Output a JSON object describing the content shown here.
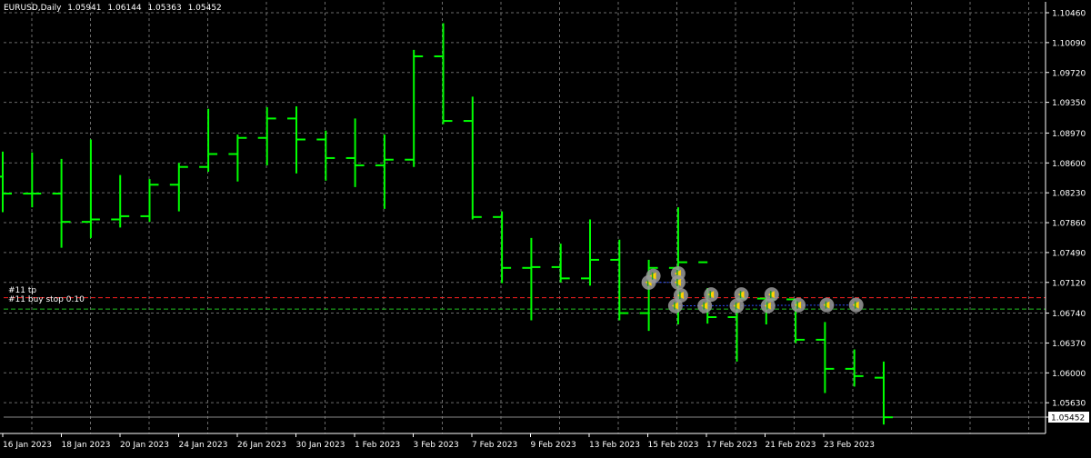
{
  "header": {
    "symbol": "EURUSD,Daily",
    "open": "1.05941",
    "high": "1.06144",
    "low": "1.05363",
    "close": "1.05452"
  },
  "pending": {
    "tp_label": "#11 tp",
    "order_label": "#11 buy stop 0.10",
    "tp_price": 1.0693,
    "order_price": 1.0679,
    "tp_color": "#ff2020",
    "order_color": "#20c020"
  },
  "current_price_label": "1.05452",
  "colors": {
    "background": "#000000",
    "bar": "#00ff00",
    "grid": "#6b6b6b",
    "axis": "#ffffff"
  },
  "chart_data": {
    "type": "ohlc",
    "ylim": [
      1.051,
      1.1052
    ],
    "y_ticks": [
      1.1046,
      1.1009,
      1.0972,
      1.0935,
      1.0897,
      1.086,
      1.0823,
      1.0786,
      1.0749,
      1.0712,
      1.0674,
      1.0637,
      1.06,
      1.0563,
      1.05452
    ],
    "y_tick_labels": [
      "1.10460",
      "1.10090",
      "1.09720",
      "1.09350",
      "1.08970",
      "1.08600",
      "1.08230",
      "1.07860",
      "1.07490",
      "1.07120",
      "1.06740",
      "1.06370",
      "1.06000",
      "1.05630",
      "1.05452"
    ],
    "x_tick_labels": [
      "16 Jan 2023",
      "18 Jan 2023",
      "20 Jan 2023",
      "24 Jan 2023",
      "26 Jan 2023",
      "30 Jan 2023",
      "1 Feb 2023",
      "3 Feb 2023",
      "7 Feb 2023",
      "9 Feb 2023",
      "13 Feb 2023",
      "15 Feb 2023",
      "17 Feb 2023",
      "21 Feb 2023",
      "23 Feb 2023"
    ],
    "bars": [
      {
        "date": "13 Jan 2023",
        "o": 1.0843,
        "h": 1.0874,
        "l": 1.0799,
        "c": 1.0822
      },
      {
        "date": "16 Jan 2023",
        "o": 1.0822,
        "h": 1.0873,
        "l": 1.0805,
        "c": 1.0822
      },
      {
        "date": "17 Jan 2023",
        "o": 1.0822,
        "h": 1.0865,
        "l": 1.0755,
        "c": 1.0787
      },
      {
        "date": "18 Jan 2023",
        "o": 1.0787,
        "h": 1.0889,
        "l": 1.0767,
        "c": 1.079
      },
      {
        "date": "19 Jan 2023",
        "o": 1.079,
        "h": 1.0845,
        "l": 1.078,
        "c": 1.0794
      },
      {
        "date": "20 Jan 2023",
        "o": 1.0794,
        "h": 1.084,
        "l": 1.0787,
        "c": 1.0833
      },
      {
        "date": "23 Jan 2023",
        "o": 1.0833,
        "h": 1.086,
        "l": 1.08,
        "c": 1.0855
      },
      {
        "date": "24 Jan 2023",
        "o": 1.0855,
        "h": 1.0927,
        "l": 1.0849,
        "c": 1.0871
      },
      {
        "date": "25 Jan 2023",
        "o": 1.0871,
        "h": 1.0895,
        "l": 1.0837,
        "c": 1.0891
      },
      {
        "date": "26 Jan 2023",
        "o": 1.0891,
        "h": 1.0929,
        "l": 1.0857,
        "c": 1.0915
      },
      {
        "date": "27 Jan 2023",
        "o": 1.0915,
        "h": 1.093,
        "l": 1.0847,
        "c": 1.0889
      },
      {
        "date": "30 Jan 2023",
        "o": 1.0889,
        "h": 1.09,
        "l": 1.0838,
        "c": 1.0866
      },
      {
        "date": "31 Jan 2023",
        "o": 1.0866,
        "h": 1.0915,
        "l": 1.083,
        "c": 1.0857
      },
      {
        "date": "1 Feb 2023",
        "o": 1.0857,
        "h": 1.0895,
        "l": 1.0803,
        "c": 1.0864
      },
      {
        "date": "2 Feb 2023",
        "o": 1.0864,
        "h": 1.1,
        "l": 1.0855,
        "c": 1.0992
      },
      {
        "date": "3 Feb 2023",
        "o": 1.0992,
        "h": 1.1033,
        "l": 1.0908,
        "c": 1.0912
      },
      {
        "date": "6 Feb 2023",
        "o": 1.0912,
        "h": 1.0942,
        "l": 1.079,
        "c": 1.0793
      },
      {
        "date": "7 Feb 2023",
        "o": 1.0793,
        "h": 1.08,
        "l": 1.0711,
        "c": 1.073
      },
      {
        "date": "8 Feb 2023",
        "o": 1.073,
        "h": 1.0767,
        "l": 1.0665,
        "c": 1.0731
      },
      {
        "date": "9 Feb 2023",
        "o": 1.0731,
        "h": 1.076,
        "l": 1.0712,
        "c": 1.0717
      },
      {
        "date": "10 Feb 2023",
        "o": 1.0717,
        "h": 1.079,
        "l": 1.0708,
        "c": 1.074
      },
      {
        "date": "13 Feb 2023",
        "o": 1.074,
        "h": 1.0765,
        "l": 1.0665,
        "c": 1.0674
      },
      {
        "date": "14 Feb 2023",
        "o": 1.0674,
        "h": 1.074,
        "l": 1.0652,
        "c": 1.073
      },
      {
        "date": "15 Feb 2023",
        "o": 1.073,
        "h": 1.0805,
        "l": 1.066,
        "c": 1.0737
      },
      {
        "date": "16 Feb 2023",
        "o": 1.0737,
        "h": 1.0705,
        "l": 1.0661,
        "c": 1.0669
      },
      {
        "date": "17 Feb 2023",
        "o": 1.0669,
        "h": 1.0685,
        "l": 1.0614,
        "c": 1.0692
      },
      {
        "date": "20 Feb 2023",
        "o": 1.0692,
        "h": 1.0695,
        "l": 1.066,
        "c": 1.0691
      },
      {
        "date": "21 Feb 2023",
        "o": 1.0691,
        "h": 1.069,
        "l": 1.0637,
        "c": 1.0641
      },
      {
        "date": "22 Feb 2023",
        "o": 1.0641,
        "h": 1.0663,
        "l": 1.0575,
        "c": 1.0605
      },
      {
        "date": "23 Feb 2023",
        "o": 1.0605,
        "h": 1.0629,
        "l": 1.0583,
        "c": 1.0596
      },
      {
        "date": "24 Feb 2023",
        "o": 1.0594,
        "h": 1.0614,
        "l": 1.0536,
        "c": 1.0545
      }
    ]
  }
}
